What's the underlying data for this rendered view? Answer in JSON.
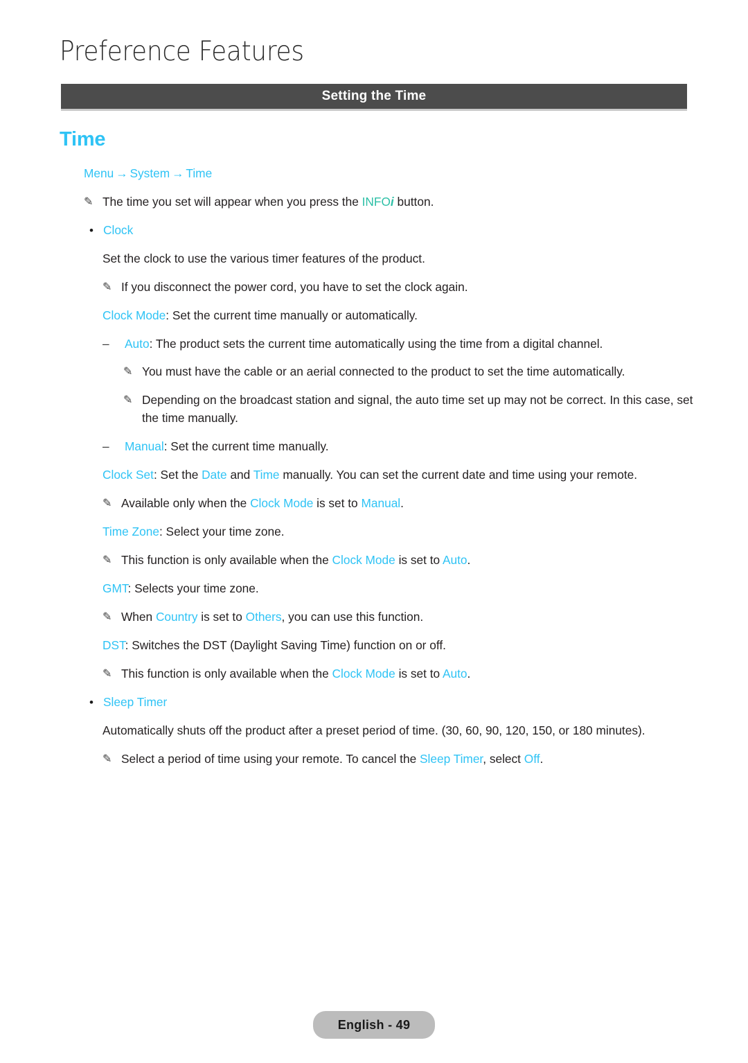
{
  "chapter": {
    "title": "Preference Features"
  },
  "banner": {
    "title": "Setting the Time"
  },
  "feature": {
    "title": "Time"
  },
  "breadcrumb": {
    "items": [
      "Menu",
      "System",
      "Time"
    ],
    "separator": "→"
  },
  "icons": {
    "note": "✎",
    "bullet": "•",
    "dash": "–"
  },
  "lines": {
    "note_info_pre": "The time you set will appear when you press the ",
    "note_info_kw": "INFO",
    "note_info_i": "i",
    "note_info_post": " button.",
    "bullet_clock": "Clock",
    "clock_desc": "Set the clock to use the various timer features of the product.",
    "note_power_cord": "If you disconnect the power cord, you have to set the clock again.",
    "clock_mode_kw": "Clock Mode",
    "clock_mode_desc": ": Set the current time manually or automatically.",
    "auto_kw": "Auto",
    "auto_desc": ": The product sets the current time automatically using the time from a digital channel.",
    "note_aerial": "You must have the cable or an aerial connected to the product to set the time automatically.",
    "note_broadcast": "Depending on the broadcast station and signal, the auto time set up may not be correct. In this case, set the time manually.",
    "manual_kw": "Manual",
    "manual_desc": ": Set the current time manually.",
    "clock_set_kw": "Clock Set",
    "clock_set_a": ": Set the ",
    "clock_set_date_kw": "Date",
    "clock_set_b": " and ",
    "clock_set_time_kw": "Time",
    "clock_set_c": " manually. You can set the current date and time using your remote.",
    "note_avail_a": "Available only when the ",
    "note_avail_kw1": "Clock Mode",
    "note_avail_b": " is set to ",
    "note_avail_kw2": "Manual",
    "note_avail_c": ".",
    "time_zone_kw": "Time Zone",
    "time_zone_desc": ": Select your time zone.",
    "note_tz_a": "This function is only available when the ",
    "note_tz_kw1": "Clock Mode",
    "note_tz_b": " is set to ",
    "note_tz_kw2": "Auto",
    "note_tz_c": ".",
    "gmt_kw": "GMT",
    "gmt_desc": ": Selects your time zone.",
    "note_country_a": "When ",
    "note_country_kw1": "Country",
    "note_country_b": " is set to ",
    "note_country_kw2": "Others",
    "note_country_c": ", you can use this function.",
    "dst_kw": "DST",
    "dst_desc": ": Switches the DST (Daylight Saving Time) function on or off.",
    "note_dst_a": "This function is only available when the ",
    "note_dst_kw1": "Clock Mode",
    "note_dst_b": " is set to ",
    "note_dst_kw2": "Auto",
    "note_dst_c": ".",
    "bullet_sleep_timer": "Sleep Timer",
    "sleep_desc": "Automatically shuts off the product after a preset period of time. (30, 60, 90, 120, 150, or 180 minutes).",
    "note_sleep_a": "Select a period of time using your remote. To cancel the ",
    "note_sleep_kw1": "Sleep Timer",
    "note_sleep_b": ", select ",
    "note_sleep_kw2": "Off",
    "note_sleep_c": "."
  },
  "footer": {
    "label": "English - 49"
  },
  "colors": {
    "accent_cyan": "#2fc3f5",
    "info_teal": "#2cbfa6",
    "banner_bg": "#4c4c4c",
    "banner_rule": "#c9c9c9",
    "footer_pill": "#bcbcbc",
    "body_text": "#231f20"
  }
}
